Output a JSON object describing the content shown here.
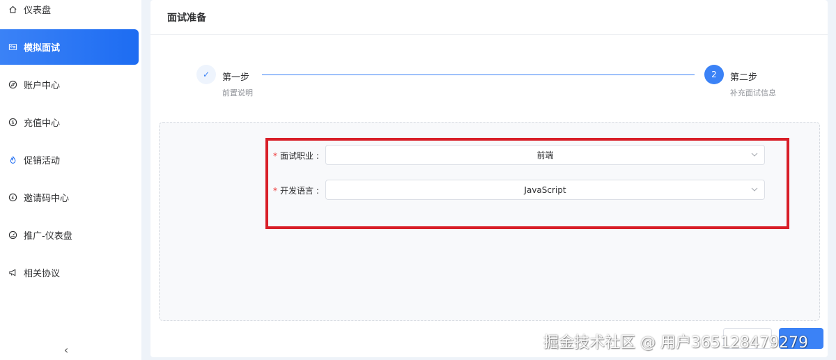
{
  "sidebar": {
    "items": [
      {
        "label": "仪表盘",
        "icon": "home-icon"
      },
      {
        "label": "模拟面试",
        "icon": "id-card-icon",
        "active": true
      },
      {
        "label": "账户中心",
        "icon": "compass-icon"
      },
      {
        "label": "充值中心",
        "icon": "dollar-icon"
      },
      {
        "label": "促销活动",
        "icon": "flame-icon"
      },
      {
        "label": "邀请码中心",
        "icon": "pound-icon"
      },
      {
        "label": "推广-仪表盘",
        "icon": "gauge-icon"
      },
      {
        "label": "相关协议",
        "icon": "megaphone-icon"
      }
    ],
    "collapse_glyph": "‹"
  },
  "main": {
    "title": "面试准备",
    "steps": [
      {
        "index": "✓",
        "title": "第一步",
        "description": "前置说明",
        "status": "done"
      },
      {
        "index": "2",
        "title": "第二步",
        "description": "补充面试信息",
        "status": "current"
      }
    ],
    "form": {
      "required_mark": "*",
      "job": {
        "label": "面试职业 :",
        "value": "前端"
      },
      "language": {
        "label": "开发语言 :",
        "value": "JavaScript"
      }
    }
  },
  "watermark": "掘金技术社区 @ 用户3651284792​79",
  "colors": {
    "accent": "#3b82f6",
    "highlight": "#d81e27",
    "required": "#e33333"
  }
}
